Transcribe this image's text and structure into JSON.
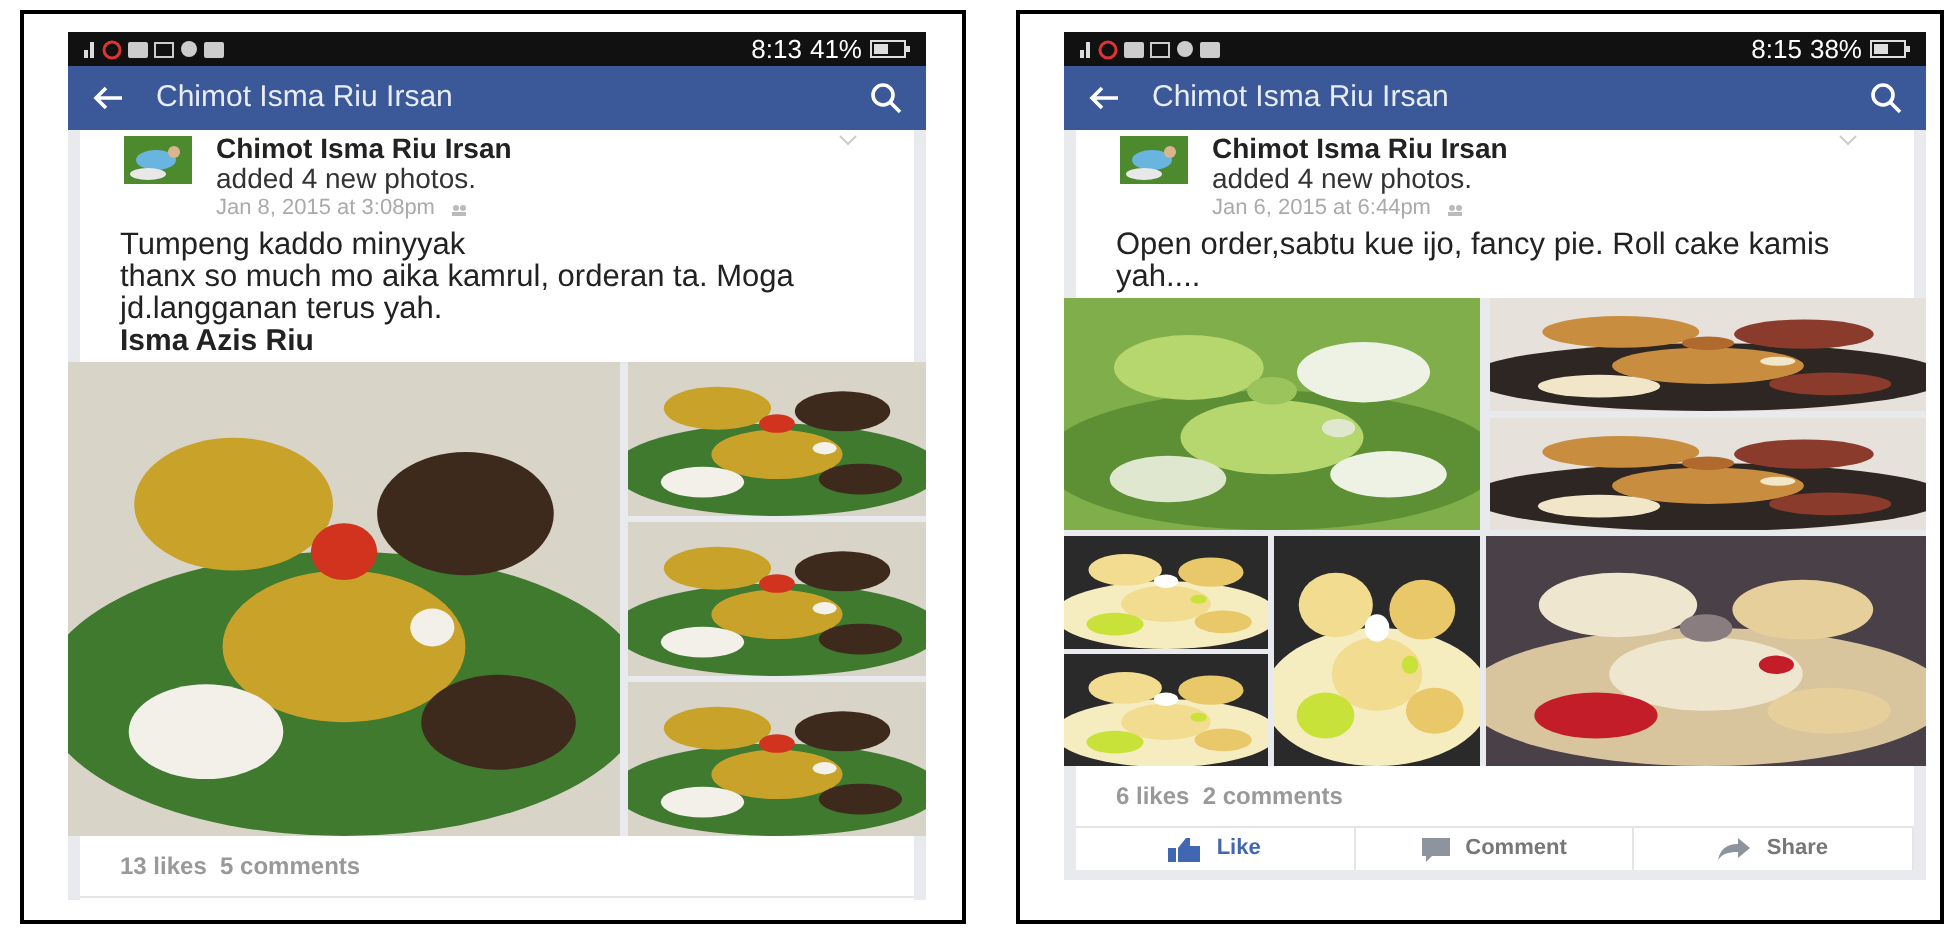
{
  "screens": [
    {
      "status_bar": {
        "time": "8:13",
        "battery": "41%"
      },
      "header": {
        "title": "Chimot Isma Riu Irsan"
      },
      "post": {
        "author": "Chimot Isma Riu Irsan",
        "action": "added 4 new photos.",
        "date": "Jan 8, 2015 at 3:08pm",
        "lines": [
          "Tumpeng kaddo minyyak",
          "thanx so much mo aika kamrul, orderan ta. Moga jd.langganan terus yah."
        ],
        "signature": "Isma Azis Riu",
        "photos": [
          {
            "kind": "picture"
          },
          {
            "kind": "picture"
          },
          {
            "kind": "picture"
          },
          {
            "kind": "picture"
          }
        ],
        "stats": "13 likes  5 comments"
      }
    },
    {
      "status_bar": {
        "time": "8:15",
        "battery": "38%"
      },
      "header": {
        "title": "Chimot Isma Riu Irsan"
      },
      "post": {
        "author": "Chimot Isma Riu Irsan",
        "action": "added 4 new photos.",
        "date": "Jan 6, 2015 at 6:44pm",
        "lines": [
          "Open order,sabtu kue ijo, fancy pie. Roll cake kamis yah...."
        ],
        "photos": [
          {
            "kind": "picture"
          },
          {
            "kind": "picture"
          },
          {
            "kind": "picture"
          },
          {
            "kind": "picture"
          },
          {
            "kind": "picture"
          },
          {
            "kind": "picture"
          },
          {
            "kind": "picture"
          }
        ],
        "stats": "6 likes  2 comments",
        "actions": [
          {
            "kind": "like",
            "label": "Like"
          },
          {
            "kind": "comment",
            "label": "Comment"
          },
          {
            "kind": "share",
            "label": "Share"
          }
        ]
      }
    }
  ]
}
